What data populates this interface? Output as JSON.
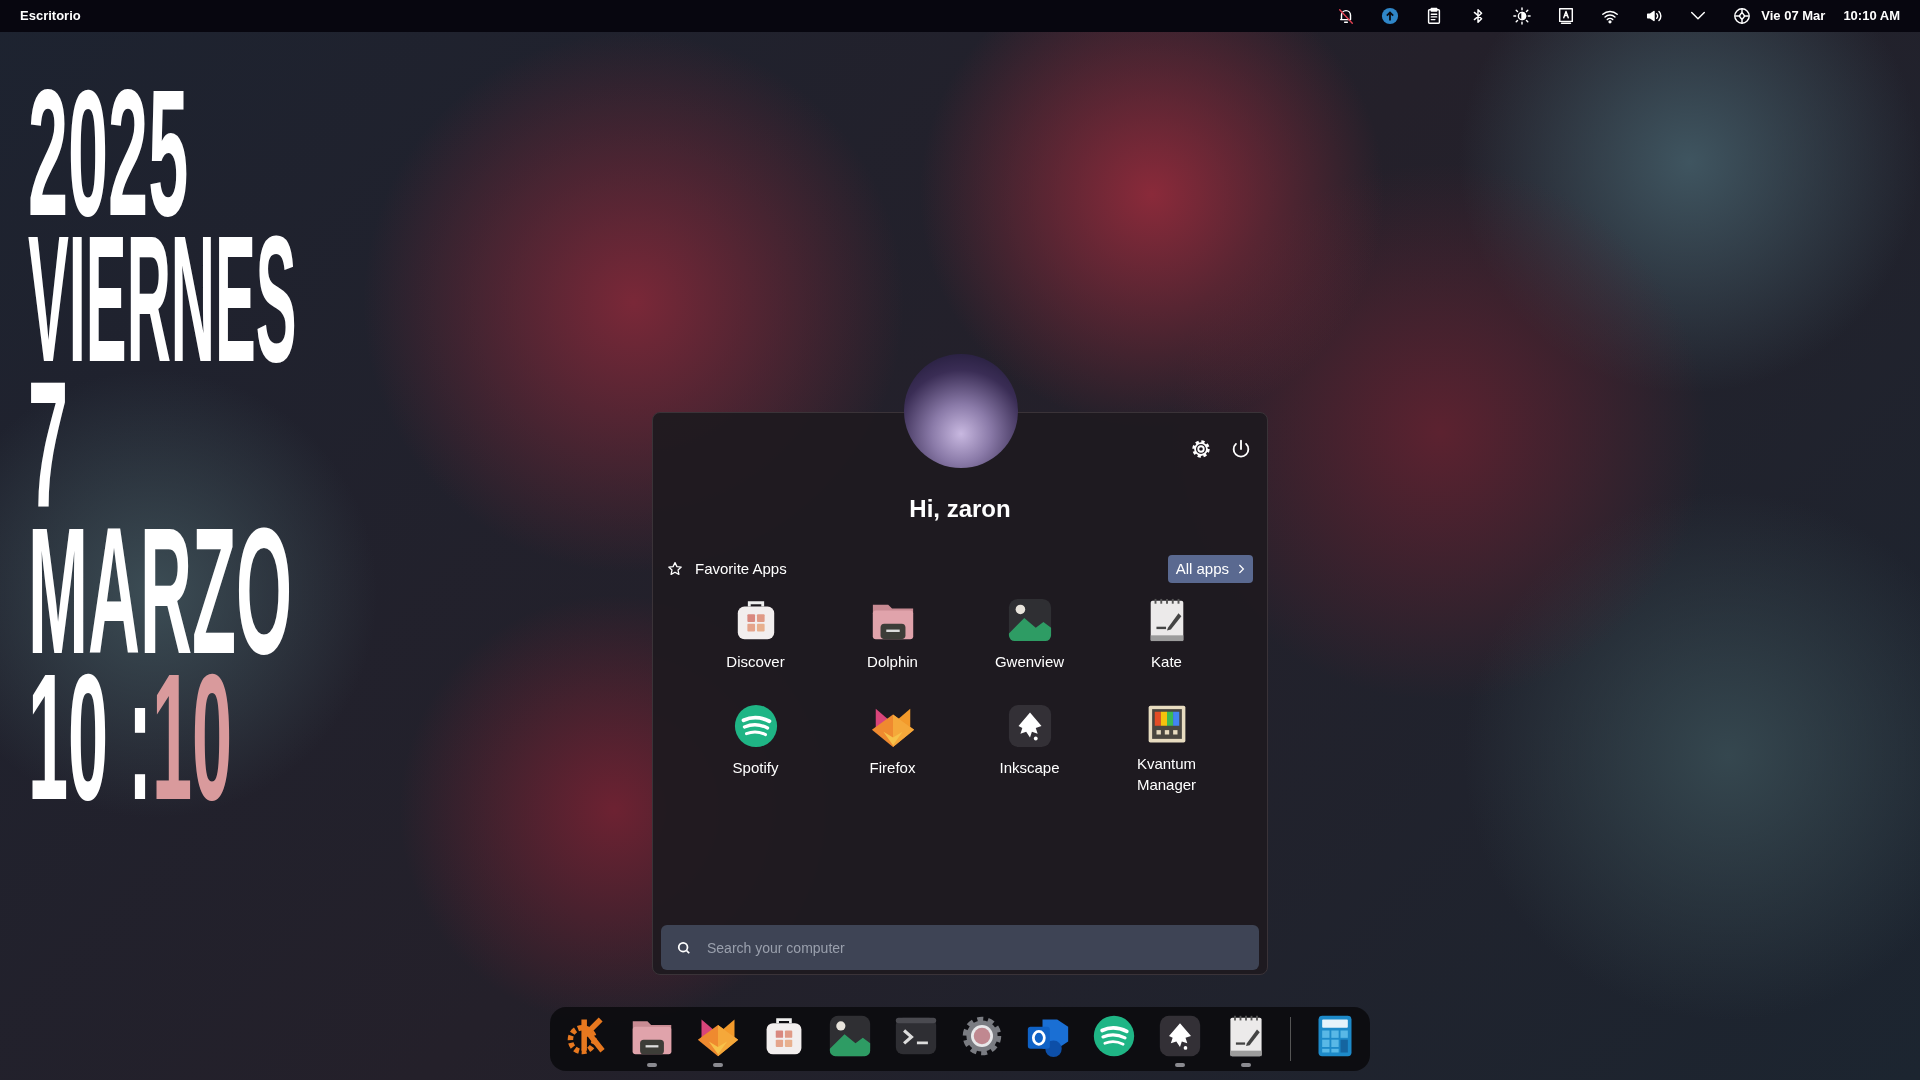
{
  "top_bar": {
    "workspace": "Escritorio",
    "tray": [
      {
        "kind": "bell-off"
      },
      {
        "kind": "update"
      },
      {
        "kind": "clipboard"
      },
      {
        "kind": "bluetooth"
      },
      {
        "kind": "brightness"
      },
      {
        "kind": "keyboard"
      },
      {
        "kind": "wifi"
      },
      {
        "kind": "volume"
      },
      {
        "kind": "expand"
      },
      {
        "kind": "network"
      }
    ],
    "date": "Vie 07 Mar",
    "time": "10:10 AM"
  },
  "clock_widget": {
    "year": "2025",
    "weekday": "VIERNES",
    "day": "7",
    "month": "MARZO",
    "hours": "10 :",
    "minutes": "10"
  },
  "launcher": {
    "greeting": "Hi, zaron",
    "section": "Favorite Apps",
    "all_apps": "All apps",
    "apps": [
      {
        "label": "Discover",
        "kind": "store"
      },
      {
        "label": "Dolphin",
        "kind": "folder"
      },
      {
        "label": "Gwenview",
        "kind": "image"
      },
      {
        "label": "Kate",
        "kind": "notepad"
      },
      {
        "label": "Spotify",
        "kind": "spotify"
      },
      {
        "label": "Firefox",
        "kind": "fox"
      },
      {
        "label": "Inkscape",
        "kind": "inkscape"
      },
      {
        "label": "Kvantum Manager",
        "kind": "kvantum"
      }
    ],
    "search": {
      "placeholder": "Search your computer"
    }
  },
  "dock": [
    {
      "kind": "kde",
      "running": false
    },
    {
      "kind": "folder",
      "running": true
    },
    {
      "kind": "fox",
      "running": true
    },
    {
      "kind": "store",
      "running": false
    },
    {
      "kind": "image",
      "running": false
    },
    {
      "kind": "terminal",
      "running": false
    },
    {
      "kind": "gear",
      "running": false
    },
    {
      "kind": "mail",
      "running": false
    },
    {
      "kind": "spotify",
      "running": false
    },
    {
      "kind": "inkscape",
      "running": true
    },
    {
      "kind": "notepad",
      "running": true
    },
    {
      "kind": "separator"
    },
    {
      "kind": "calculator",
      "running": false
    }
  ]
}
